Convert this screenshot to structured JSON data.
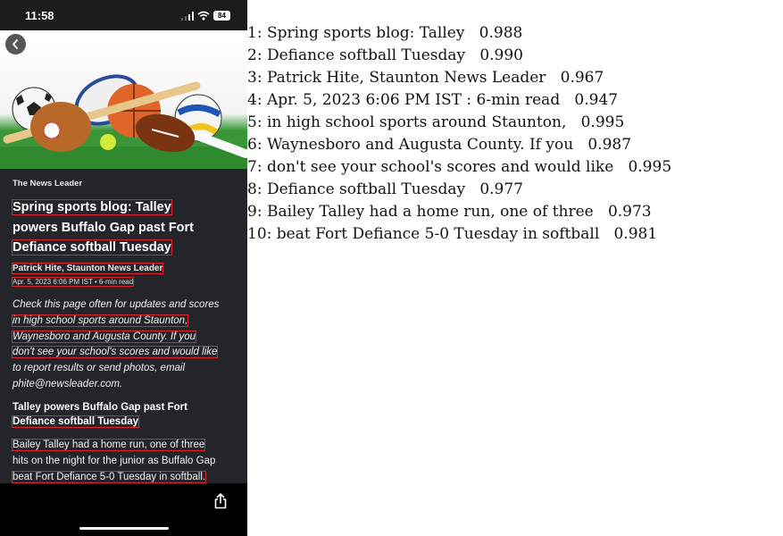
{
  "status_bar": {
    "time": "11:58",
    "battery": "84"
  },
  "article": {
    "publisher": "The News Leader",
    "headline": [
      "Spring sports blog: Talley",
      "powers Buffalo Gap past Fort",
      "Defiance softball Tuesday"
    ],
    "byline": "Patrick Hite, Staunton News Leader",
    "dateline": "Apr. 5, 2023 6:06 PM IST • 6-min read",
    "intro": [
      "Check this page often for updates and scores",
      "in high school sports around Staunton,",
      "Waynesboro and Augusta County. If you",
      "don't see your school's scores and would like",
      "to report results or send photos, email",
      "phite@newsleader.com."
    ],
    "subhead": [
      "Talley powers Buffalo Gap past Fort",
      "Defiance softball Tuesday"
    ],
    "body": [
      "Bailey Talley had a home run, one of three",
      "hits on the night for the junior as Buffalo Gap",
      "beat Fort Defiance 5-0 Tuesday in softball."
    ]
  },
  "ocr_results": [
    {
      "index": "1",
      "text": "Spring sports blog: Talley",
      "score": "0.988"
    },
    {
      "index": "2",
      "text": "Defiance softball Tuesday",
      "score": "0.990"
    },
    {
      "index": "3",
      "text": "Patrick Hite, Staunton News Leader",
      "score": "0.967"
    },
    {
      "index": "4",
      "text": "Apr. 5, 2023 6:06 PM IST : 6-min read",
      "score": "0.947"
    },
    {
      "index": "5",
      "text": "in high school sports around Staunton,",
      "score": "0.995"
    },
    {
      "index": "6",
      "text": "Waynesboro and Augusta County. If you",
      "score": "0.987"
    },
    {
      "index": "7",
      "text": "don't see your school's scores and would like",
      "score": "0.995"
    },
    {
      "index": "8",
      "text": "Defiance softball Tuesday",
      "score": "0.977"
    },
    {
      "index": "9",
      "text": "Bailey Talley had a home run, one of three",
      "score": "0.973"
    },
    {
      "index": "10",
      "text": "beat Fort Defiance 5-0 Tuesday in softball",
      "score": "0.981"
    }
  ],
  "colors": {
    "highlight_box": "#e0242a",
    "article_bg": "#24252b"
  },
  "icons": [
    "back-icon",
    "share-icon",
    "wifi-icon",
    "signal-icon",
    "battery-icon"
  ]
}
